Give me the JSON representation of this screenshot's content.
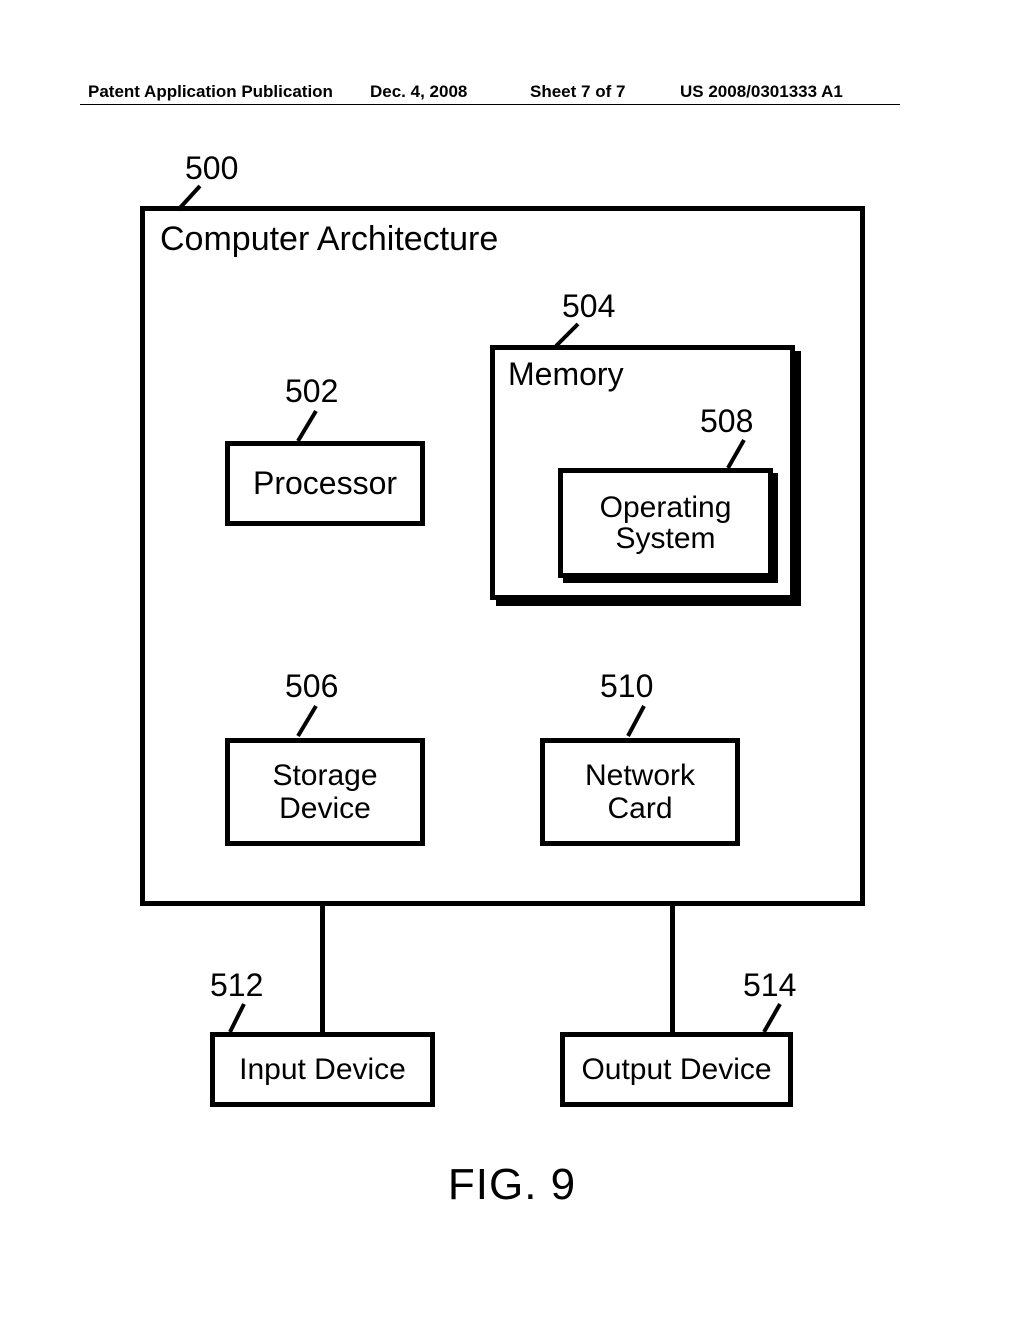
{
  "header": {
    "publication": "Patent Application Publication",
    "date": "Dec. 4, 2008",
    "sheet": "Sheet 7 of 7",
    "pubno": "US 2008/0301333 A1"
  },
  "refs": {
    "r500": "500",
    "r502": "502",
    "r504": "504",
    "r506": "506",
    "r508": "508",
    "r510": "510",
    "r512": "512",
    "r514": "514"
  },
  "labels": {
    "architecture": "Computer Architecture",
    "processor": "Processor",
    "memory": "Memory",
    "os": "Operating\nSystem",
    "storage": "Storage\nDevice",
    "network": "Network\nCard",
    "input": "Input Device",
    "output": "Output Device"
  },
  "figure": "FIG. 9"
}
